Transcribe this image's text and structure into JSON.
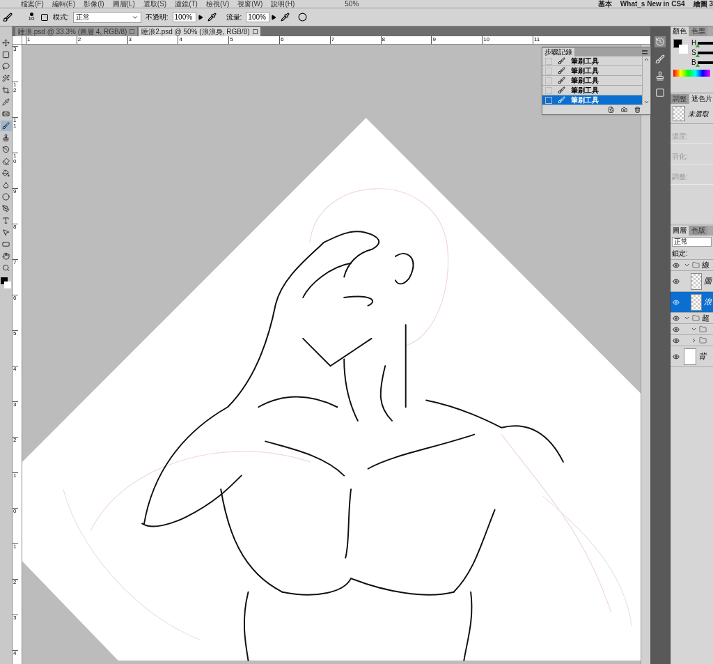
{
  "menu": [
    "檔案(F)",
    "編輯(E)",
    "影像(I)",
    "圖層(L)",
    "選取(S)",
    "濾鏡(T)",
    "檢視(V)",
    "視窗(W)",
    "說明(H)"
  ],
  "zoom_value": "50%",
  "workspaces": [
    "基本",
    "What_s New in CS4",
    "繪圖 3"
  ],
  "options": {
    "brush_size": "10",
    "mode_label": "模式:",
    "mode": "正常",
    "opacity_label": "不透明:",
    "opacity": "100%",
    "flow_label": "流量:",
    "flow": "100%"
  },
  "tabs": [
    {
      "label": "睡浪.psd @ 33.3% (圖層 4, RGB/8)",
      "selected": false
    },
    {
      "label": "睡浪2.psd @ 50% (浪浪身, RGB/8)",
      "selected": true
    }
  ],
  "ruler_h": [
    "1",
    "2",
    "3",
    "4",
    "5",
    "6",
    "7",
    "8",
    "9",
    "10",
    "11"
  ],
  "ruler_v": [
    "3",
    "12",
    "11",
    "10",
    "9",
    "8",
    "7",
    "6",
    "5",
    "4",
    "3",
    "2",
    "1",
    "0",
    "1",
    "2",
    "3",
    "4"
  ],
  "tools": [
    {
      "selected": false
    },
    {
      "selected": false
    },
    {
      "selected": false
    },
    {
      "selected": false
    },
    {
      "selected": false
    },
    {
      "selected": false
    },
    {
      "selected": false
    },
    {
      "selected": true
    },
    {
      "selected": false
    },
    {
      "selected": false
    },
    {
      "selected": false
    },
    {
      "selected": false
    },
    {
      "selected": false
    },
    {
      "selected": false
    },
    {
      "selected": false
    },
    {
      "selected": false
    },
    {
      "selected": false
    },
    {
      "selected": false
    },
    {
      "selected": false
    },
    {
      "selected": false
    }
  ],
  "history": {
    "title": "步驟記錄",
    "items": [
      {
        "label": "筆刷工具",
        "selected": false
      },
      {
        "label": "筆刷工具",
        "selected": false
      },
      {
        "label": "筆刷工具",
        "selected": false
      },
      {
        "label": "筆刷工具",
        "selected": false
      },
      {
        "label": "筆刷工具",
        "selected": true
      }
    ]
  },
  "color_panel": {
    "tabs": [
      {
        "label": "顏色",
        "selected": true
      },
      {
        "label": "色票",
        "selected": false
      }
    ],
    "sliders": [
      {
        "label": "H",
        "level": 0
      },
      {
        "label": "S",
        "level": 0
      },
      {
        "label": "B",
        "level": 0
      }
    ]
  },
  "adjust_panel": {
    "tabs": [
      {
        "label": "調整",
        "selected": false
      },
      {
        "label": "遮色片",
        "selected": true
      }
    ],
    "mask_name": "未選取",
    "fields": [
      "濃度:",
      "羽化:",
      "調整:"
    ]
  },
  "layers_panel": {
    "tabs": [
      {
        "label": "圖層",
        "selected": true
      },
      {
        "label": "色版",
        "selected": false
      }
    ],
    "blend": "正常",
    "lock_label": "鎖定:",
    "layers": [
      {
        "kind": "group",
        "name": "線",
        "expanded": true,
        "selected": false,
        "children": [
          {
            "kind": "layer",
            "name": "圖",
            "selected": false
          },
          {
            "kind": "layer",
            "name": "浪",
            "selected": true
          }
        ]
      },
      {
        "kind": "group",
        "name": "超",
        "expanded": true,
        "selected": false,
        "children": [
          {
            "kind": "group",
            "expanded": true,
            "selected": false
          },
          {
            "kind": "group",
            "expanded": false,
            "selected": false
          }
        ]
      },
      {
        "kind": "background",
        "name": "背",
        "selected": false
      }
    ]
  }
}
